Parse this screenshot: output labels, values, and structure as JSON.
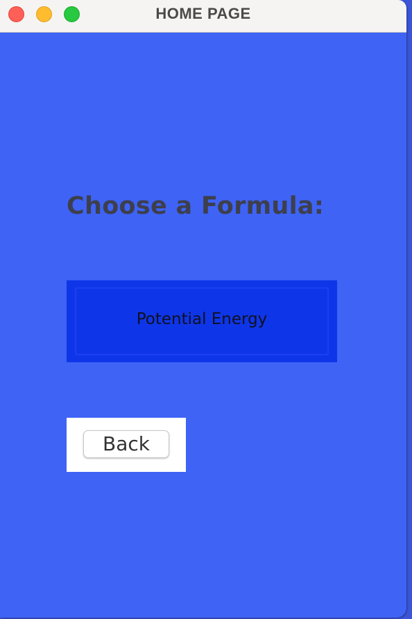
{
  "window": {
    "title": "HOME PAGE",
    "background_color": "#3e63f5"
  },
  "titlebar_buttons": [
    "close",
    "minimize",
    "maximize"
  ],
  "main": {
    "heading": "Choose a Formula:",
    "formula_button_label": "Potential Energy",
    "formula_button_color": "#0e36e8",
    "back_button_label": "Back"
  }
}
